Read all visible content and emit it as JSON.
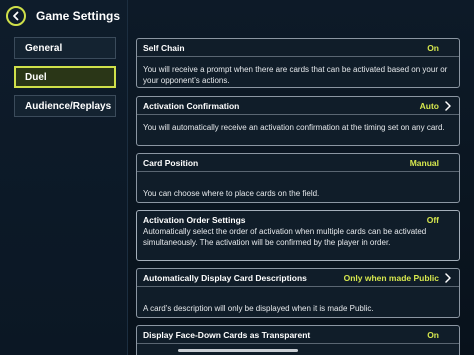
{
  "header": {
    "title": "Game Settings",
    "back_icon": "chevron-left-icon"
  },
  "sidebar": {
    "items": [
      {
        "label": "General",
        "active": false
      },
      {
        "label": "Duel",
        "active": true
      },
      {
        "label": "Audience/Replays",
        "active": false
      }
    ]
  },
  "settings": [
    {
      "name": "Self Chain",
      "value": "On",
      "has_arrow": false,
      "description": "You will receive a prompt when there are cards that can be activated based on your or your opponent’s actions."
    },
    {
      "name": "Activation Confirmation",
      "value": "Auto",
      "has_arrow": true,
      "description": "You will automatically receive an activation confirmation at the timing set on any card."
    },
    {
      "name": "Card Position",
      "value": "Manual",
      "has_arrow": false,
      "description": "You can choose where to place cards on the field."
    },
    {
      "name": "Activation Order Settings",
      "value": "Off",
      "has_arrow": false,
      "description": "Automatically select the order of activation when multiple cards can be activated simultaneously. The activation will be confirmed by the player in order."
    },
    {
      "name": "Automatically Display Card Descriptions",
      "value": "Only when made Public",
      "has_arrow": true,
      "description": "A card’s description will only be displayed when it is made Public."
    },
    {
      "name": "Display Face-Down Cards as Transparent",
      "value": "On",
      "has_arrow": false,
      "description": ""
    }
  ],
  "colors": {
    "accent": "#cfe04a",
    "value_text": "#d7e84e",
    "background": "#0b1520"
  }
}
